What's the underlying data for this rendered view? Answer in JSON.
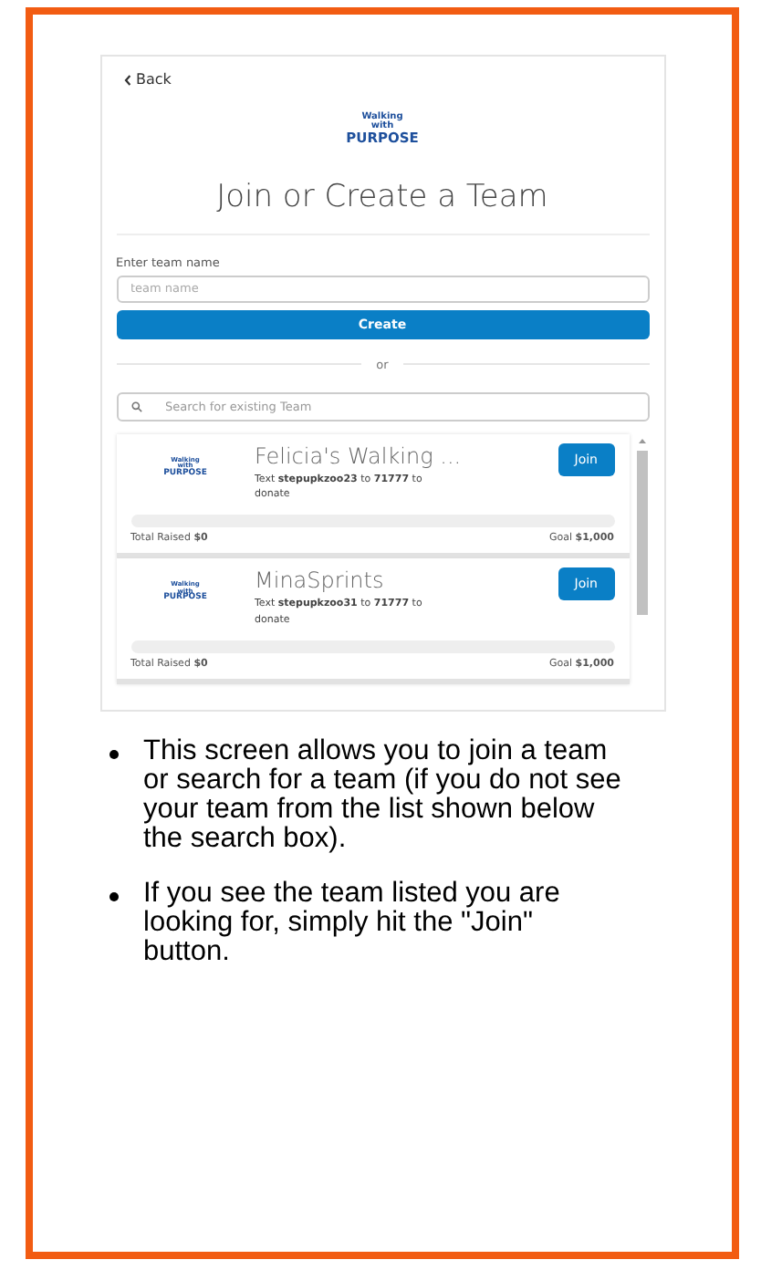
{
  "app": {
    "back": "Back",
    "logo": {
      "line1": "Walking",
      "line2": "with",
      "line3": "PURPOSE"
    },
    "title": "Join or Create a Team",
    "create_form": {
      "label": "Enter team name",
      "placeholder": "team name",
      "button": "Create"
    },
    "divider": "or",
    "search": {
      "placeholder": "Search for existing Team"
    },
    "teams": [
      {
        "logo": {
          "line1": "Walking",
          "line2": "with",
          "line3": "PURPOSE"
        },
        "name": "Felicia's Walking ...",
        "donate_text": "Text **stepupkzoo23** to **71777** to donate",
        "join": "Join",
        "level": 0,
        "raised_label": "Total Raised",
        "raised": "$0",
        "goal_label": "Goal",
        "goal": "$1,000"
      },
      {
        "logo": {
          "line1": "Walking",
          "line2": "with",
          "line3": "PURPOSE"
        },
        "name": "MinaSprints",
        "donate_text": "Text **stepupkzoo31** to **71777** to donate",
        "join": "Join",
        "level": 0,
        "raised_label": "Total Raised",
        "raised": "$0",
        "goal_label": "Goal",
        "goal": "$1,000"
      }
    ]
  },
  "notes": [
    "This screen allows you to join a team or search for a team (if you do not see your team from the list shown below the search box).",
    "If you see the team listed you are looking for, simply hit the \"Join\" button."
  ]
}
